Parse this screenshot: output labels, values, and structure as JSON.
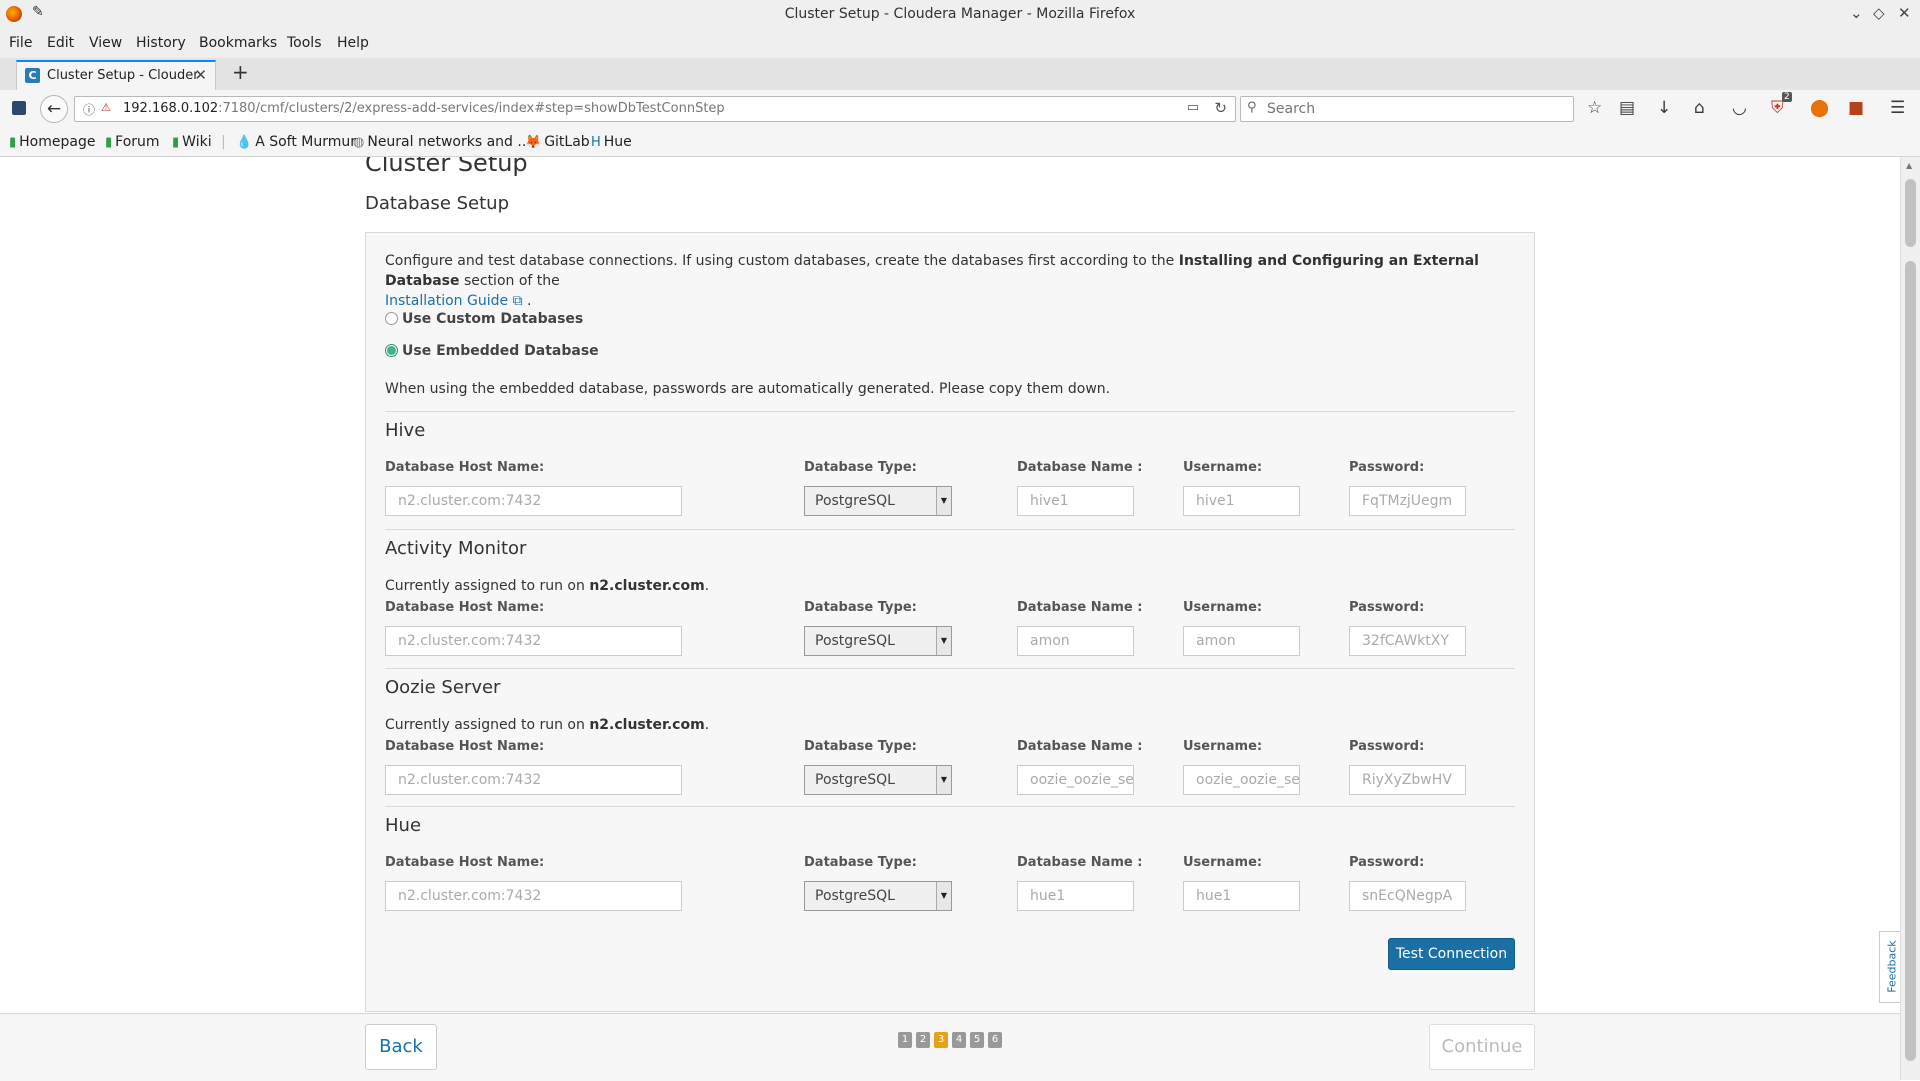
{
  "window": {
    "title": "Cluster Setup - Cloudera Manager - Mozilla Firefox"
  },
  "menu": [
    "File",
    "Edit",
    "View",
    "History",
    "Bookmarks",
    "Tools",
    "Help"
  ],
  "tab": {
    "label": "Cluster Setup - Cloudera",
    "favicon_letter": "C"
  },
  "address": {
    "host": "192.168.0.102",
    "rest": ":7180/cmf/clusters/2/express-add-services/index#step=showDbTestConnStep"
  },
  "search": {
    "placeholder": "Search"
  },
  "toolbar_badge": "2",
  "bookmarks": [
    "Homepage",
    "Forum",
    "Wiki",
    "A Soft Murmur",
    "Neural networks and ...",
    "GitLab",
    "Hue"
  ],
  "page": {
    "title": "Cluster Setup",
    "subtitle": "Database Setup",
    "intro_text": "Configure and test database connections. If using custom databases, create the databases first according to the ",
    "intro_bold": "Installing and Configuring an External Database",
    "intro_after": " section of the",
    "intro_link": "Installation Guide",
    "intro_end": " .",
    "radio_custom": "Use Custom Databases",
    "radio_embedded": "Use Embedded Database",
    "selected_radio": "Use Embedded Database",
    "note": "When using the embedded database, passwords are automatically generated. Please copy them down.",
    "field_labels": {
      "host": "Database Host Name:",
      "type": "Database Type:",
      "name": "Database Name :",
      "user": "Username:",
      "password": "Password:"
    },
    "assigned_prefix": "Currently assigned to run on ",
    "assigned_suffix": ".",
    "sections": [
      {
        "heading": "Hive",
        "assigned_host": "",
        "host": "n2.cluster.com:7432",
        "type": "PostgreSQL",
        "db_name": "hive1",
        "username": "hive1",
        "password": "FqTMzjUegm"
      },
      {
        "heading": "Activity Monitor",
        "assigned_host": "n2.cluster.com",
        "host": "n2.cluster.com:7432",
        "type": "PostgreSQL",
        "db_name": "amon",
        "username": "amon",
        "password": "32fCAWktXY"
      },
      {
        "heading": "Oozie Server",
        "assigned_host": "n2.cluster.com",
        "host": "n2.cluster.com:7432",
        "type": "PostgreSQL",
        "db_name": "oozie_oozie_serv",
        "username": "oozie_oozie_serv",
        "password": "RiyXyZbwHV"
      },
      {
        "heading": "Hue",
        "assigned_host": "",
        "host": "n2.cluster.com:7432",
        "type": "PostgreSQL",
        "db_name": "hue1",
        "username": "hue1",
        "password": "snEcQNegpA"
      }
    ],
    "test_button": "Test Connection"
  },
  "footer": {
    "back": "Back",
    "continue": "Continue",
    "steps": [
      "1",
      "2",
      "3",
      "4",
      "5",
      "6"
    ],
    "current_step": "3"
  },
  "feedback": "Feedback",
  "colors": {
    "link": "#1a6fa5",
    "primary_button": "#1a6fa5",
    "current_step": "#e4a21b",
    "radio_selected": "#3cb38c"
  }
}
